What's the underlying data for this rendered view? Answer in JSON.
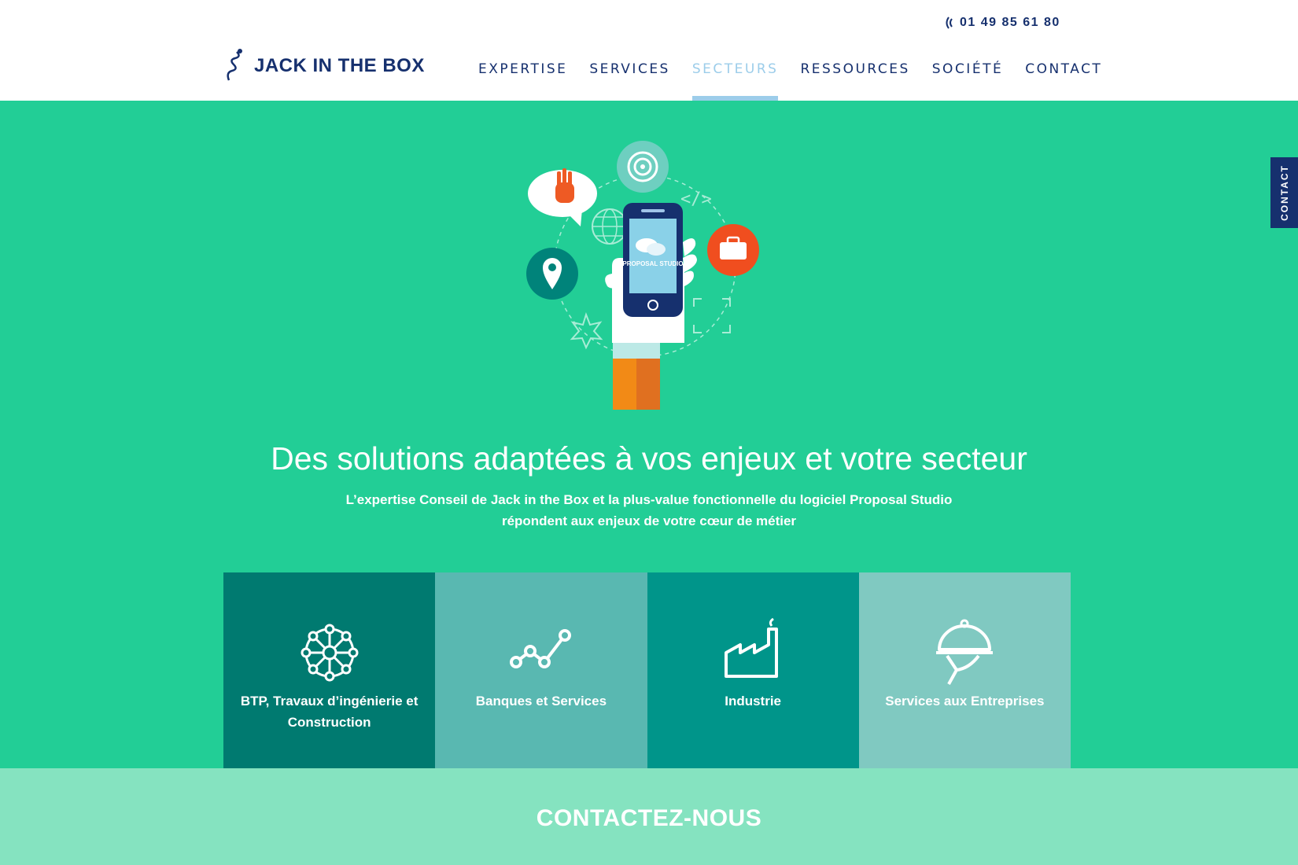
{
  "header": {
    "phone": "01 49 85 61 80",
    "logo_text": "JACK IN THE BOX",
    "nav": [
      {
        "label": "EXPERTISE",
        "active": false
      },
      {
        "label": "SERVICES",
        "active": false
      },
      {
        "label": "SECTEURS",
        "active": true
      },
      {
        "label": "RESSOURCES",
        "active": false
      },
      {
        "label": "SOCIÉTÉ",
        "active": false
      },
      {
        "label": "CONTACT",
        "active": false
      }
    ]
  },
  "hero": {
    "illustration_text": "PROPOSAL STUDIO",
    "title": "Des solutions adaptées à vos enjeux et votre secteur",
    "subtitle_line1": "L’expertise Conseil de Jack in the Box et la plus-value fonctionnelle du logiciel Proposal Studio",
    "subtitle_line2": "répondent aux enjeux de votre cœur de métier"
  },
  "sectors": [
    {
      "label": "BTP, Travaux d’ingénierie et Construction",
      "icon": "wheel-icon",
      "color": "#007a70"
    },
    {
      "label": "Banques et Services",
      "icon": "trend-icon",
      "color": "#59b8b1"
    },
    {
      "label": "Industrie",
      "icon": "factory-icon",
      "color": "#00958a"
    },
    {
      "label": "Services aux Entreprises",
      "icon": "cloche-icon",
      "color": "#80c9c1"
    }
  ],
  "contact_band": {
    "label": "CONTACTEZ-NOUS"
  },
  "side_tab": {
    "label": "CONTACT"
  },
  "colors": {
    "navy": "#16306e",
    "hero_green": "#22ce96",
    "band_green": "#85e3c0",
    "active_nav": "#9ccdea"
  }
}
